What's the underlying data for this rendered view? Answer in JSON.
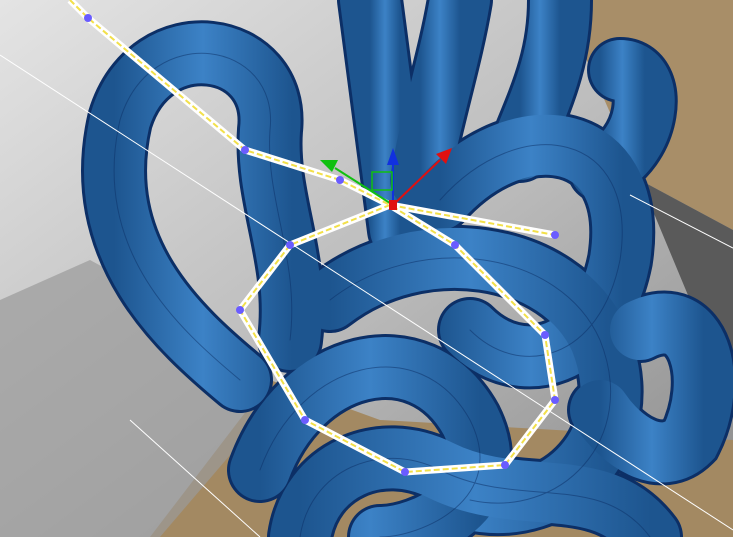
{
  "viewport": {
    "colors": {
      "tube": "#2a6cb0",
      "tube_light": "#4f95d6",
      "tube_wire": "#0c2f66",
      "spline": "#f2e04a",
      "vertex": "#6a5cff",
      "ground_light": "#d9d9d9",
      "ground_dark": "#7d7d7d",
      "box": "#a98f6a",
      "gizmo_x": "#e01010",
      "gizmo_y": "#10c010",
      "gizmo_z": "#1030e0"
    }
  }
}
